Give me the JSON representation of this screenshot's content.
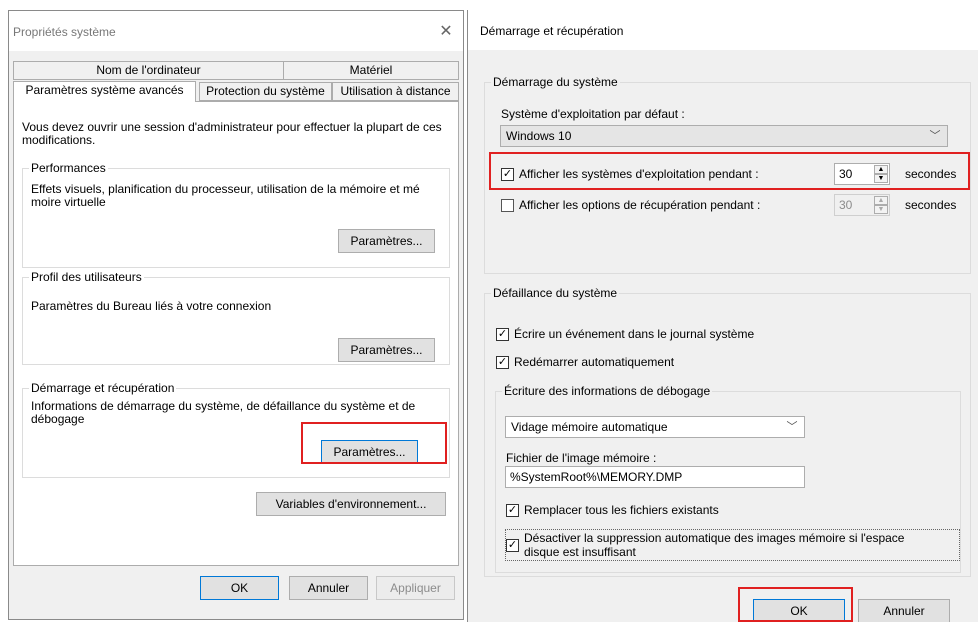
{
  "left": {
    "title": "Propriétés système",
    "tabs_row1": [
      "Nom de l'ordinateur",
      "Matériel"
    ],
    "tabs_row2": [
      "Paramètres système avancés",
      "Protection du système",
      "Utilisation à distance"
    ],
    "intro": "Vous devez ouvrir une session d'administrateur pour effectuer la plupart de ces modifications.",
    "performance": {
      "legend": "Performances",
      "desc": "Effets visuels, planification du processeur, utilisation de la mémoire et mé moire virtuelle",
      "button": "Paramètres..."
    },
    "profiles": {
      "legend": "Profil des utilisateurs",
      "desc": "Paramètres du Bureau liés à votre connexion",
      "button": "Paramètres..."
    },
    "startup": {
      "legend": "Démarrage et récupération",
      "desc": "Informations de démarrage du système, de défaillance du système et de débogage",
      "button": "Paramètres..."
    },
    "env_button": "Variables d'environnement...",
    "ok": "OK",
    "cancel": "Annuler",
    "apply": "Appliquer"
  },
  "right": {
    "title": "Démarrage et récupération",
    "system_startup": {
      "legend": "Démarrage du système",
      "default_os_label": "Système d'exploitation par défaut :",
      "default_os_value": "Windows 10",
      "show_os_label": "Afficher les systèmes d'exploitation pendant :",
      "show_os_value": "30",
      "show_os_unit": "secondes",
      "show_recovery_label": "Afficher les options de récupération pendant :",
      "show_recovery_value": "30",
      "show_recovery_unit": "secondes"
    },
    "system_failure": {
      "legend": "Défaillance du système",
      "write_event": "Écrire un événement dans le journal système",
      "auto_restart": "Redémarrer automatiquement",
      "debug_legend": "Écriture des informations de débogage",
      "dump_type": "Vidage mémoire automatique",
      "dump_file_label": "Fichier de l'image mémoire :",
      "dump_file_value": "%SystemRoot%\\MEMORY.DMP",
      "overwrite": "Remplacer tous les fichiers existants",
      "disable_auto_delete_line1": "Désactiver la suppression automatique des images mémoire si l'espace",
      "disable_auto_delete_line2": "disque est insuffisant"
    },
    "ok": "OK",
    "cancel": "Annuler"
  },
  "accent": {
    "highlight": "#e02020",
    "focus": "#0078d7"
  }
}
